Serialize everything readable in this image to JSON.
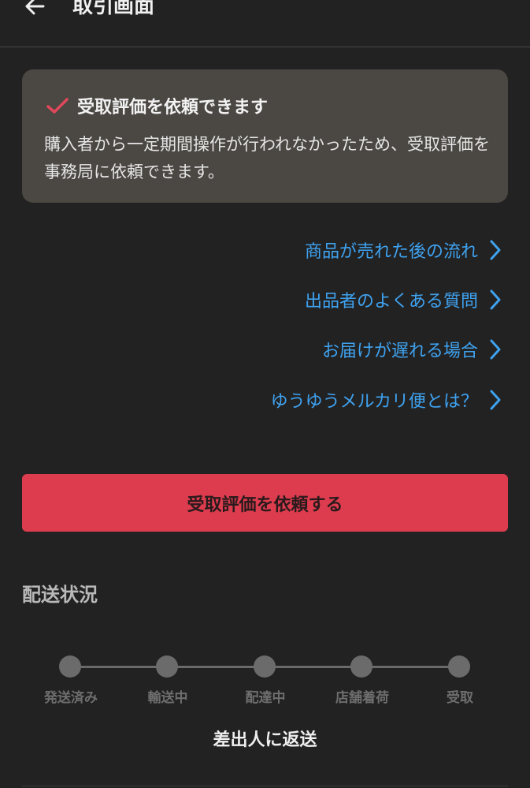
{
  "header": {
    "title": "取引画面",
    "back_icon": "arrow-left-icon"
  },
  "notice": {
    "icon": "check-icon",
    "title": "受取評価を依頼できます",
    "body": "購入者から一定期間操作が行われなかったため、受取評価を事務局に依頼できます。",
    "check_color": "#e0485a"
  },
  "links": [
    {
      "label": "商品が売れた後の流れ"
    },
    {
      "label": "出品者のよくある質問"
    },
    {
      "label": "お届けが遅れる場合"
    },
    {
      "label": "ゆうゆうメルカリ便とは？"
    }
  ],
  "cta": {
    "label": "受取評価を依頼する",
    "color": "#dc3c4e"
  },
  "shipping": {
    "section_title": "配送状況",
    "steps": [
      "発送済み",
      "輸送中",
      "配達中",
      "店舗着荷",
      "受取"
    ],
    "status": "差出人に返送"
  },
  "colors": {
    "accent_link": "#3fa2ef",
    "background": "#222223"
  }
}
